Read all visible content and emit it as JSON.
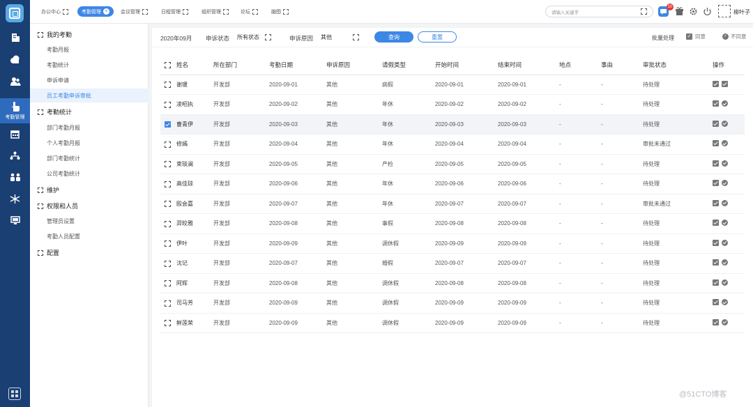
{
  "topbar": {
    "tabs": [
      "办公中心",
      "考勤管理",
      "会议管理",
      "日程管理",
      "组织管理",
      "论坛",
      "脑图"
    ],
    "active_tab": "考勤管理",
    "search_placeholder": "请输入关键字",
    "message_badge": "10",
    "username": "柳叶子"
  },
  "rail": {
    "active_caption": "考勤管理"
  },
  "sidebar": {
    "groups": [
      {
        "label": "我的考勤",
        "items": [
          "考勤月报",
          "考勤统计",
          "申诉申请",
          "员工考勤申诉审批"
        ]
      },
      {
        "label": "考勤统计",
        "items": [
          "部门考勤月报",
          "个人考勤月报",
          "部门考勤统计",
          "公司考勤统计"
        ]
      },
      {
        "label": "维护",
        "items": []
      },
      {
        "label": "权限和人员",
        "items": [
          "管理员设置",
          "考勤人员配置"
        ]
      },
      {
        "label": "配置",
        "items": []
      }
    ],
    "active_item": "员工考勤申诉审批"
  },
  "filter": {
    "month": "2020年09月",
    "status_label": "申诉状态",
    "status_value": "所有状态",
    "reason_label": "申诉原因",
    "reason_value": "其他",
    "query": "查询",
    "reset": "重置",
    "batch": "批量处理",
    "agree": "同意",
    "disagree": "不同意"
  },
  "table": {
    "headers": [
      "姓名",
      "所在部门",
      "考勤日期",
      "申诉原因",
      "请假类型",
      "开始时间",
      "结束时间",
      "地点",
      "事由",
      "审批状态",
      "操作"
    ],
    "rows": [
      [
        "谢瑗",
        "开发部",
        "2020-09-01",
        "其他",
        "病假",
        "2020-09-01",
        "2020-09-01",
        "-",
        "-",
        "待处理"
      ],
      [
        "凌昭执",
        "开发部",
        "2020-09-02",
        "其他",
        "年休",
        "2020-09-02",
        "2020-09-02",
        "-",
        "-",
        "待处理"
      ],
      [
        "曹青伊",
        "开发部",
        "2020-09-03",
        "其他",
        "年休",
        "2020-09-03",
        "2020-09-03",
        "-",
        "-",
        "待处理"
      ],
      [
        "修嫣",
        "开发部",
        "2020-09-04",
        "其他",
        "年休",
        "2020-09-04",
        "2020-09-04",
        "-",
        "-",
        "审批未通过"
      ],
      [
        "束琰澜",
        "开发部",
        "2020-09-05",
        "其他",
        "产检",
        "2020-09-05",
        "2020-09-05",
        "-",
        "-",
        "待处理"
      ],
      [
        "高佳琼",
        "开发部",
        "2020-09-06",
        "其他",
        "年休",
        "2020-09-06",
        "2020-09-06",
        "-",
        "-",
        "待处理"
      ],
      [
        "殴会嘉",
        "开发部",
        "2020-09-07",
        "其他",
        "年休",
        "2020-09-07",
        "2020-09-07",
        "-",
        "-",
        "审批未通过"
      ],
      [
        "羿皎雅",
        "开发部",
        "2020-09-08",
        "其他",
        "事假",
        "2020-09-08",
        "2020-09-08",
        "-",
        "-",
        "待处理"
      ],
      [
        "伊叶",
        "开发部",
        "2020-09-09",
        "其他",
        "调休假",
        "2020-09-09",
        "2020-09-09",
        "-",
        "-",
        "待处理"
      ],
      [
        "沈记",
        "开发部",
        "2020-09-07",
        "其他",
        "婚假",
        "2020-09-07",
        "2020-09-07",
        "-",
        "-",
        "待处理"
      ],
      [
        "阿辉",
        "开发部",
        "2020-09-08",
        "其他",
        "调休假",
        "2020-09-08",
        "2020-09-08",
        "-",
        "-",
        "待处理"
      ],
      [
        "司马芳",
        "开发部",
        "2020-09-09",
        "其他",
        "调休假",
        "2020-09-09",
        "2020-09-09",
        "-",
        "-",
        "待处理"
      ],
      [
        "鲜莲荣",
        "开发部",
        "2020-09-09",
        "其他",
        "调休假",
        "2020-09-09",
        "2020-09-09",
        "-",
        "-",
        "待处理"
      ]
    ],
    "checked_row": 2
  },
  "watermark": "@51CTO博客",
  "colors": {
    "primary": "#3d87e6",
    "rail": "#1a3f73"
  }
}
